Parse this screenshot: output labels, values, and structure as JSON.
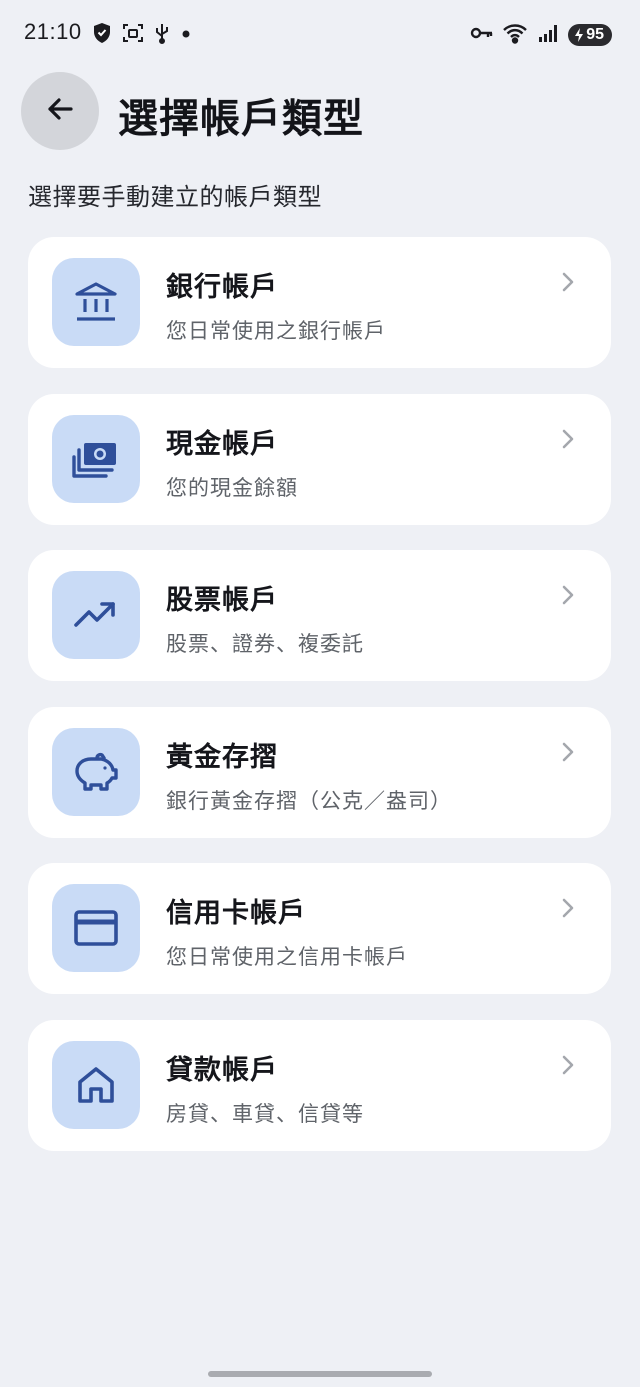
{
  "status_bar": {
    "time": "21:10",
    "battery_level": "95",
    "left_icons": [
      "shield-icon",
      "screenshot-icon",
      "usb-icon",
      "dot-icon"
    ],
    "right_icons": [
      "vpn-key-icon",
      "wifi-icon",
      "signal-icon",
      "battery-icon"
    ]
  },
  "header": {
    "title": "選擇帳戶類型",
    "back_icon": "arrow-left-icon"
  },
  "subtitle": "選擇要手動建立的帳戶類型",
  "accent_color": "#2f4f9a",
  "icon_bg_color": "#c9dbf6",
  "account_types": [
    {
      "title": "銀行帳戶",
      "description": "您日常使用之銀行帳戶",
      "icon": "bank-icon"
    },
    {
      "title": "現金帳戶",
      "description": "您的現金餘額",
      "icon": "cash-icon"
    },
    {
      "title": "股票帳戶",
      "description": "股票、證券、複委託",
      "icon": "trending-up-icon"
    },
    {
      "title": "黃金存摺",
      "description": "銀行黃金存摺（公克／盎司）",
      "icon": "piggy-bank-icon"
    },
    {
      "title": "信用卡帳戶",
      "description": "您日常使用之信用卡帳戶",
      "icon": "credit-card-icon"
    },
    {
      "title": "貸款帳戶",
      "description": "房貸、車貸、信貸等",
      "icon": "home-icon"
    }
  ]
}
